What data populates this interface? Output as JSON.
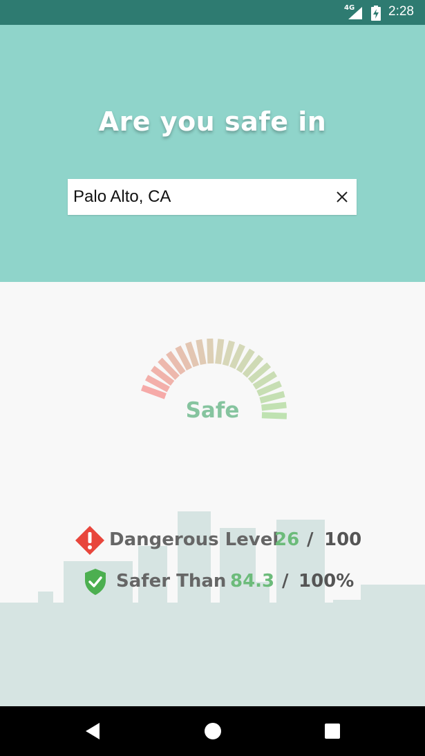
{
  "status_bar": {
    "network": "4G",
    "time": "2:28",
    "icons": [
      "signal-icon",
      "battery-charging-icon"
    ]
  },
  "header": {
    "title": "Are you safe in",
    "search": {
      "value": "Palo Alto, CA",
      "clear_icon": "close-icon"
    },
    "background": "#8fd4ca"
  },
  "gauge": {
    "label": "Safe",
    "level_percent": 26,
    "colors": {
      "danger": "#f6aaa8",
      "mid": "#d8d6b8",
      "safe": "#bfe2b1"
    }
  },
  "stats": {
    "dangerous": {
      "icon": "warning-diamond-icon",
      "label": "Dangerous Level",
      "value": "26",
      "separator": "/",
      "max": "100"
    },
    "safer": {
      "icon": "shield-check-icon",
      "label": "Safer Than",
      "value": "84.3",
      "separator": "/",
      "max": "100%"
    }
  },
  "colors": {
    "status_bar": "#2e7b71",
    "accent_green": "#6cbb7a",
    "danger_red": "#e8463c",
    "shield_green": "#4caf50",
    "skyline": "#d6e4e2"
  },
  "nav_bar": {
    "icons": [
      "back-icon",
      "home-icon",
      "recents-icon"
    ]
  }
}
